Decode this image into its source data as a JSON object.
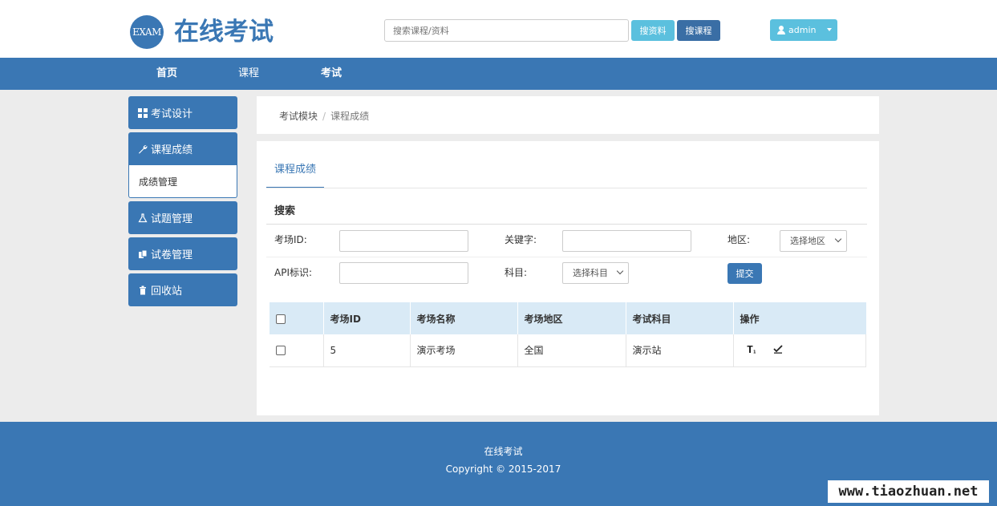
{
  "header": {
    "logo_badge": "EXAM",
    "logo_text": "在线考试",
    "search_placeholder": "搜索课程/资料",
    "search_data_label": "搜资料",
    "search_course_label": "搜课程",
    "user_label": "admin"
  },
  "nav": {
    "items": [
      {
        "label": "首页"
      },
      {
        "label": "课程"
      },
      {
        "label": "考试"
      }
    ]
  },
  "sidebar": {
    "items": [
      {
        "label": "考试设计",
        "icon": "grid-icon"
      },
      {
        "label": "课程成绩",
        "icon": "wrench-icon"
      },
      {
        "label": "成绩管理",
        "icon": ""
      },
      {
        "label": "试题管理",
        "icon": "flask-icon"
      },
      {
        "label": "试卷管理",
        "icon": "copy-icon"
      },
      {
        "label": "回收站",
        "icon": "trash-icon"
      }
    ]
  },
  "breadcrumb": {
    "parent": "考试模块",
    "separator": "/",
    "current": "课程成绩"
  },
  "tab": {
    "label": "课程成绩"
  },
  "search": {
    "heading": "搜索",
    "room_id_label": "考场ID:",
    "keyword_label": "关键字:",
    "region_label": "地区:",
    "region_select": "选择地区",
    "api_label": "API标识:",
    "subject_label": "科目:",
    "subject_select": "选择科目",
    "submit_label": "提交"
  },
  "table": {
    "headers": [
      "考场ID",
      "考场名称",
      "考场地区",
      "考试科目",
      "操作"
    ],
    "rows": [
      {
        "id": "5",
        "name": "演示考场",
        "region": "全国",
        "subject": "演示站"
      }
    ],
    "op_icons": [
      "text-height-icon",
      "check-icon"
    ]
  },
  "footer": {
    "title": "在线考试",
    "copyright": "Copyright © 2015-2017"
  },
  "watermark": "www.tiaozhuan.net",
  "colors": {
    "primary": "#3a77b4",
    "info": "#5bc0de",
    "table_head": "#d9eaf6"
  }
}
